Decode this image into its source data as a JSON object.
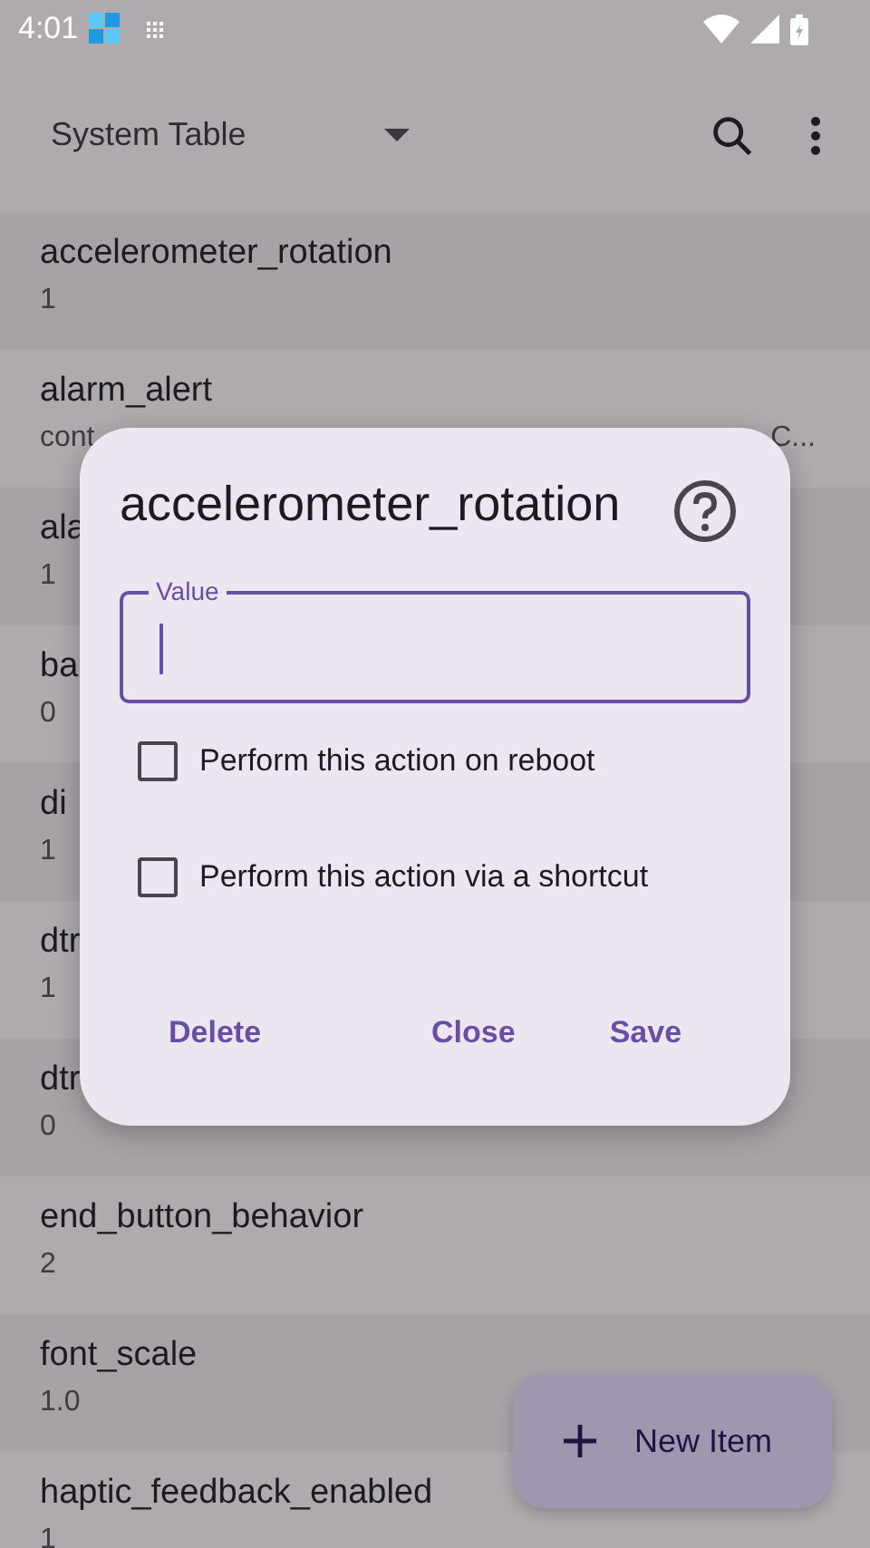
{
  "status_bar": {
    "time": "4:01"
  },
  "toolbar": {
    "title": "System Table"
  },
  "rows": [
    {
      "name": "accelerometer_rotation",
      "value": "1"
    },
    {
      "name": "alarm_alert",
      "value": "cont",
      "value_end": "C..."
    },
    {
      "name": "ala",
      "value": "1"
    },
    {
      "name": "ba",
      "value": "0"
    },
    {
      "name": "di",
      "value": "1"
    },
    {
      "name": "dtr",
      "value": "1"
    },
    {
      "name": "dtr",
      "value": "0"
    },
    {
      "name": "end_button_behavior",
      "value": "2"
    },
    {
      "name": "font_scale",
      "value": "1.0"
    },
    {
      "name": "haptic_feedback_enabled",
      "value": "1"
    }
  ],
  "dialog": {
    "title": "accelerometer_rotation",
    "field": {
      "label": "Value"
    },
    "options": [
      {
        "label": "Perform this action on reboot",
        "checked": false
      },
      {
        "label": "Perform this action via a shortcut",
        "checked": false
      }
    ],
    "buttons": [
      "Delete",
      "Close",
      "Save"
    ]
  },
  "fab": {
    "label": "New Item"
  }
}
